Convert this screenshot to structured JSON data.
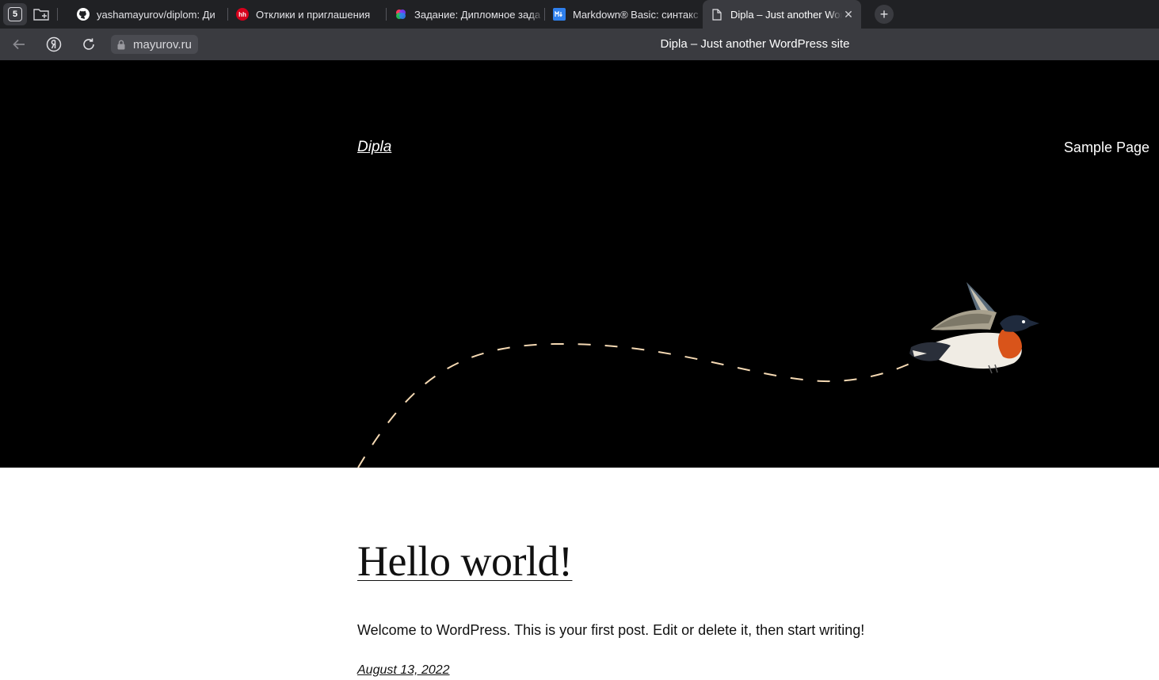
{
  "browser": {
    "tab_count": "5",
    "tabs": [
      {
        "title": "yashamayurov/diplom: Ди",
        "favicon": "github-icon"
      },
      {
        "title": "Отклики и приглашения",
        "favicon": "hh-icon",
        "favicon_text": "hh",
        "color": "#d6001c"
      },
      {
        "title": "Задание: Дипломное зада",
        "favicon": "netology-icon"
      },
      {
        "title": "Markdown® Basic: синтакс",
        "favicon": "markdown-icon",
        "color": "#2f80ed"
      },
      {
        "title": "Dipla – Just another Wor",
        "favicon": "page-icon",
        "active": true
      }
    ],
    "url": "mayurov.ru",
    "page_title": "Dipla – Just another WordPress site"
  },
  "site": {
    "title": "Dipla",
    "menu": [
      "Sample Page"
    ],
    "colors": {
      "hero_bg": "#000000",
      "dash": "#f5d9b3"
    }
  },
  "post": {
    "title": "Hello world!",
    "excerpt": "Welcome to WordPress. This is your first post. Edit or delete it, then start writing!",
    "date": "August 13, 2022"
  }
}
